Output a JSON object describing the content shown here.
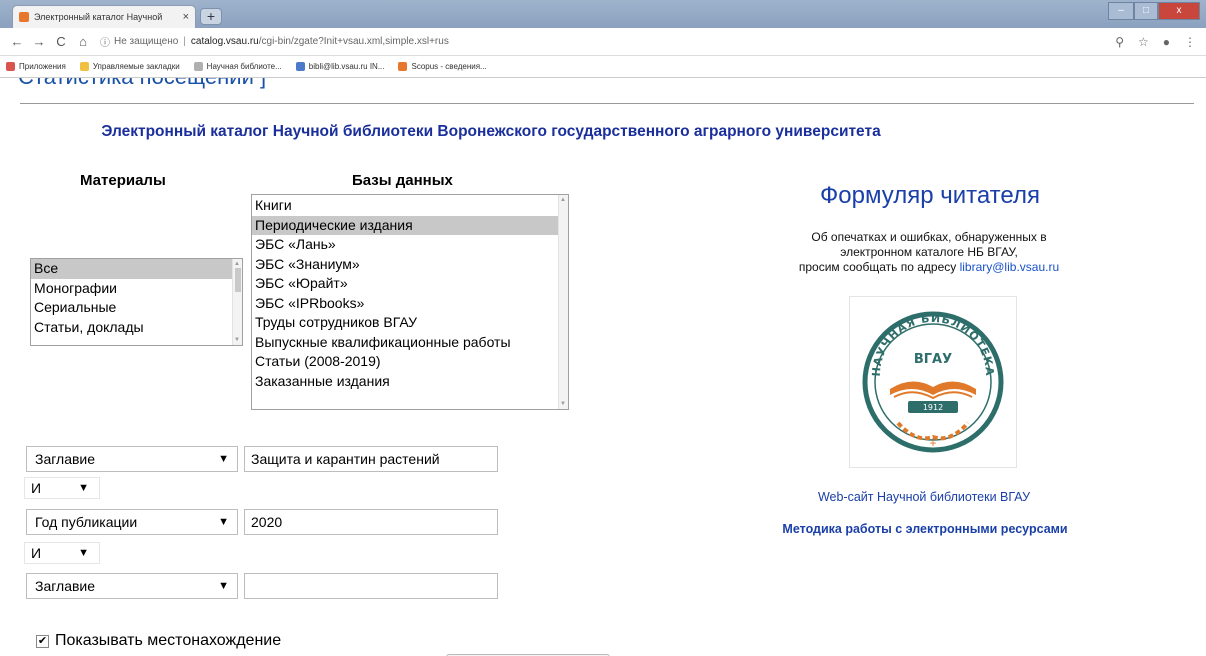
{
  "browser": {
    "tab_title": "Электронный каталог Научной",
    "tab_close": "×",
    "new_tab": "+",
    "window_min": "‒",
    "window_max": "□",
    "window_close": "x",
    "url_info": "ⓘ",
    "url_insecure": "Не защищено",
    "url_host": "catalog.vsau.ru",
    "url_path": "/cgi-bin/zgate?Init+vsau.xml,simple.xsl+rus",
    "bookmarks": [
      {
        "label": "Приложения",
        "color": "#d9534f"
      },
      {
        "label": "Управляемые закладки",
        "color": "#f0c040"
      },
      {
        "label": "Научная библиоте...",
        "color": "#b0b0b0"
      },
      {
        "label": "bibli@lib.vsau.ru IN...",
        "color": "#4a7ac8"
      },
      {
        "label": "Scopus - сведения...",
        "color": "#e8772e"
      }
    ]
  },
  "page": {
    "stats_link": "Статистика посещений ]",
    "catalog_title": "Электронный каталог Научной библиотеки Воронежского государственного аграрного университета",
    "materials_header": "Материалы",
    "databases_header": "Базы данных",
    "materials": [
      {
        "label": "Все",
        "selected": true
      },
      {
        "label": "Монографии",
        "selected": false
      },
      {
        "label": "Сериальные",
        "selected": false
      },
      {
        "label": "Статьи, доклады",
        "selected": false
      }
    ],
    "databases": [
      {
        "label": "Книги",
        "selected": false
      },
      {
        "label": "Периодические издания",
        "selected": true
      },
      {
        "label": "ЭБС «Лань»",
        "selected": false
      },
      {
        "label": "ЭБС «Знаниум»",
        "selected": false
      },
      {
        "label": "ЭБС «Юрайт»",
        "selected": false
      },
      {
        "label": "ЭБС «IPRbooks»",
        "selected": false
      },
      {
        "label": "Труды сотрудников ВГАУ",
        "selected": false
      },
      {
        "label": "Выпускные квалификационные работы",
        "selected": false
      },
      {
        "label": "Статьи (2008-2019)",
        "selected": false
      },
      {
        "label": "Заказанные издания",
        "selected": false
      }
    ],
    "search": {
      "field1": "Заглавие",
      "value1": "Защита и карантин растений",
      "op1": "И",
      "field2": "Год публикации",
      "value2": "2020",
      "op2": "И",
      "field3": "Заглавие",
      "value3": ""
    },
    "show_location_label": "Показывать местонахождение",
    "show_location_checked": "✔",
    "reader_form_title": "Формуляр читателя",
    "notice_line1": "Об опечатках и ошибках, обнаруженных в",
    "notice_line2": "электронном каталоге НБ ВГАУ,",
    "notice_line3": "просим сообщать по адресу ",
    "notice_email": "library@lib.vsau.ru",
    "site_link": "Web-сайт Научной библиотеки ВГАУ",
    "method_link": "Методика работы с электронными ресурсами",
    "logo": {
      "arc_text": "НАУЧНАЯ БИБЛИОТЕКА",
      "center_text": "ВГАУ",
      "year": "1912",
      "ring_color": "#2e6e6a",
      "accent_color": "#e07a2a"
    }
  }
}
